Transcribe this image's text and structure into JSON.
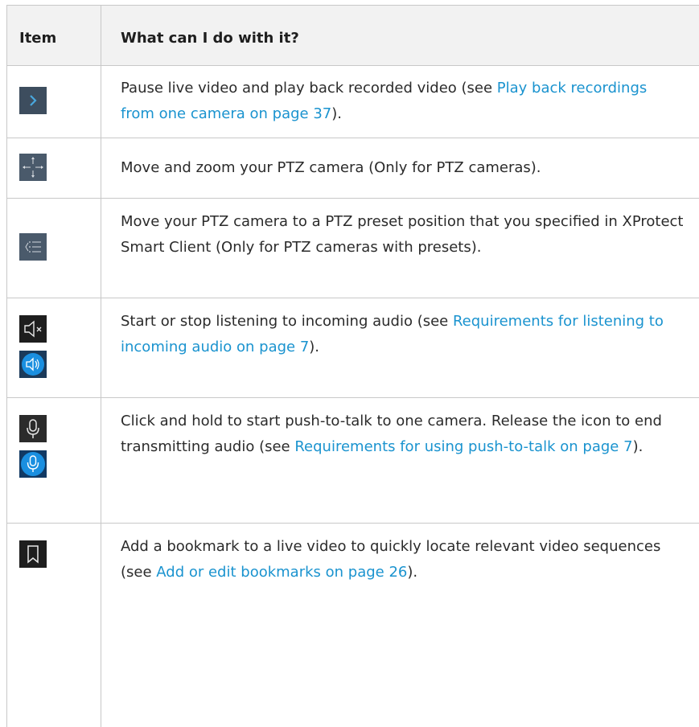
{
  "table": {
    "headers": {
      "item": "Item",
      "description": "What can I do with it?"
    },
    "rows": [
      {
        "icons": [
          "chevron-right-icon"
        ],
        "text_before": "Pause live video and play back recorded video (see ",
        "link": "Play back recordings from one camera on page 37",
        "text_after": ")."
      },
      {
        "icons": [
          "ptz-move-icon"
        ],
        "text_before": "Move and zoom your PTZ camera (Only for PTZ cameras).",
        "link": "",
        "text_after": ""
      },
      {
        "icons": [
          "ptz-preset-list-icon"
        ],
        "text_before": "Move your PTZ camera to a PTZ preset position that you specified in XProtect Smart Client (Only for PTZ cameras with presets).",
        "link": "",
        "text_after": ""
      },
      {
        "icons": [
          "speaker-muted-icon",
          "speaker-active-icon"
        ],
        "text_before": "Start or stop listening to incoming audio (see ",
        "link": "Requirements for listening to incoming audio on page 7",
        "text_after": ")."
      },
      {
        "icons": [
          "microphone-icon",
          "microphone-active-icon"
        ],
        "text_before": "Click and hold to start push-to-talk to one camera. Release the icon to end transmitting audio (see ",
        "link": "Requirements for using push-to-talk on page 7",
        "text_after": ")."
      },
      {
        "icons": [
          "bookmark-icon"
        ],
        "text_before": "Add a bookmark to a live video to quickly locate relevant video sequences (see ",
        "link": "Add or edit bookmarks on page 26",
        "text_after": ")."
      }
    ]
  },
  "colors": {
    "link": "#1a93cf",
    "icon_bg": "#3d4d5e",
    "icon_active": "#1a8fe0",
    "border": "#c8c8c8",
    "header_bg": "#f2f2f2"
  }
}
